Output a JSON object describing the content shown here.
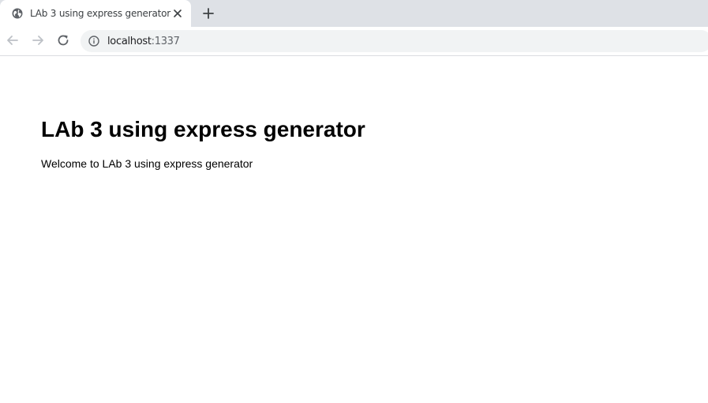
{
  "browser": {
    "tab": {
      "title": "LAb 3 using express generator",
      "favicon": "globe-icon",
      "close_icon": "close-icon"
    },
    "new_tab_icon": "plus-icon",
    "toolbar": {
      "back_icon": "arrow-left-icon",
      "forward_icon": "arrow-right-icon",
      "reload_icon": "reload-icon"
    },
    "omnibox": {
      "info_icon": "info-icon",
      "host": "localhost",
      "port": ":1337"
    }
  },
  "page": {
    "heading": "LAb 3 using express generator",
    "text": "Welcome to LAb 3 using express generator"
  },
  "colors": {
    "tabstrip_bg": "#dee1e6",
    "omnibox_bg": "#f1f3f4",
    "icon": "#5f6368"
  }
}
